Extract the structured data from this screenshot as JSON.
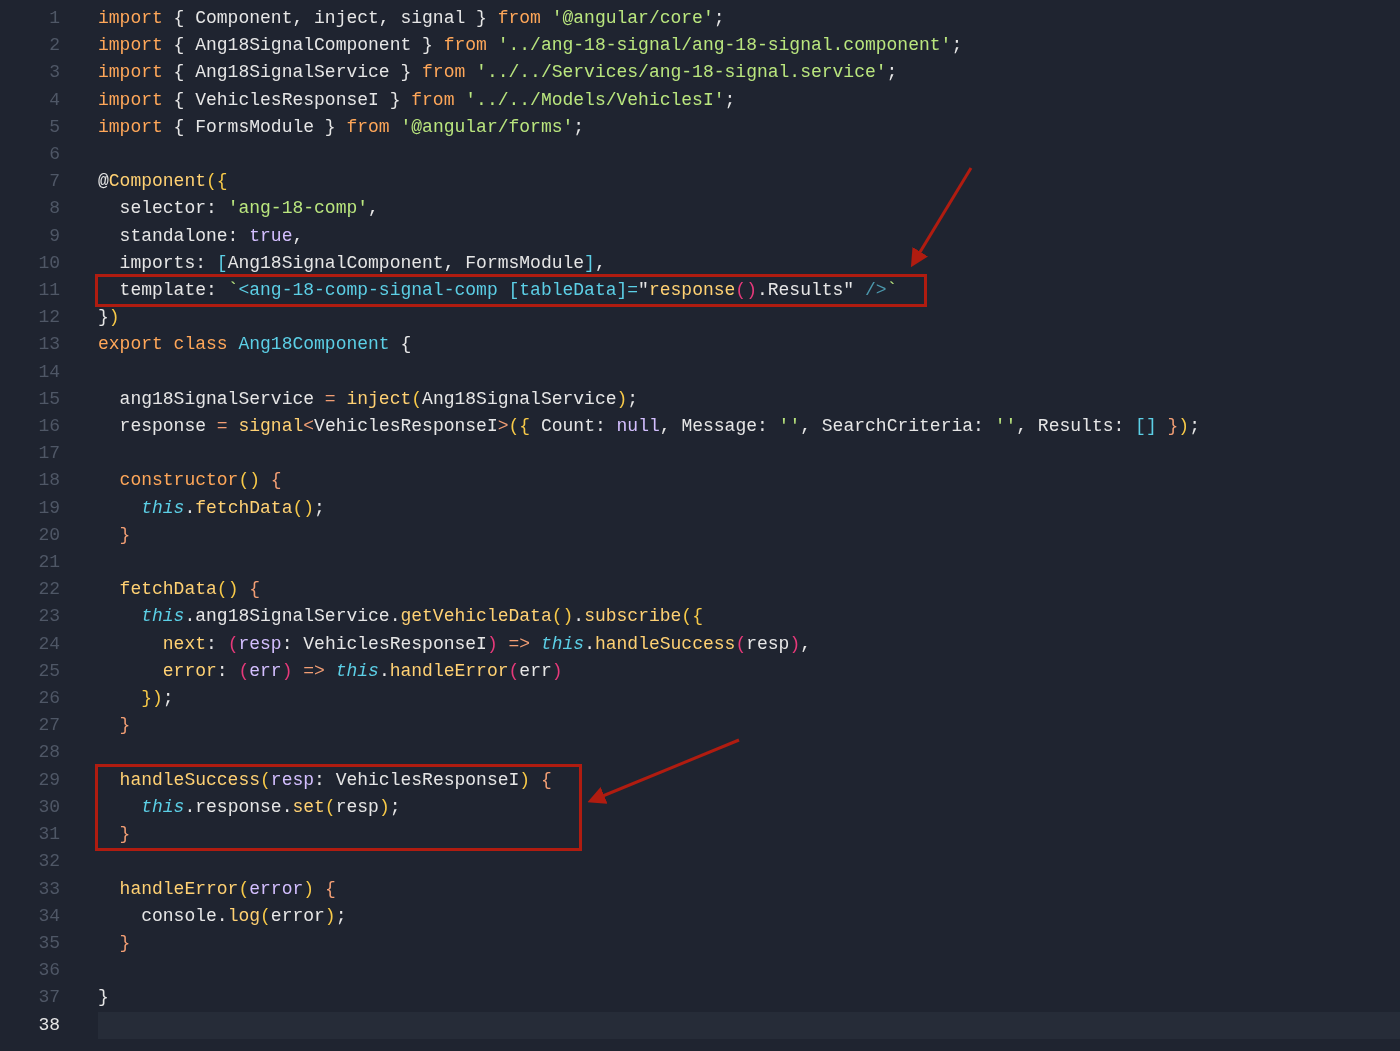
{
  "editor": {
    "lines": [
      {
        "number": "1",
        "current": false,
        "boxed": false,
        "tokens": [
          {
            "text": "import",
            "kind": "kw"
          },
          {
            "text": " { Component, inject, signal } ",
            "kind": "plain"
          },
          {
            "text": "from",
            "kind": "kw"
          },
          {
            "text": " '@angular/core'",
            "kind": "str"
          },
          {
            "text": ";",
            "kind": "plain"
          }
        ]
      },
      {
        "number": "2",
        "current": false,
        "boxed": false,
        "tokens": [
          {
            "text": "import",
            "kind": "kw"
          },
          {
            "text": " { Ang18SignalComponent } ",
            "kind": "plain"
          },
          {
            "text": "from",
            "kind": "kw"
          },
          {
            "text": " '../ang-18-signal/ang-18-signal.component'",
            "kind": "str"
          },
          {
            "text": ";",
            "kind": "plain"
          }
        ]
      },
      {
        "number": "3",
        "current": false,
        "boxed": false,
        "tokens": [
          {
            "text": "import",
            "kind": "kw"
          },
          {
            "text": " { Ang18SignalService } ",
            "kind": "plain"
          },
          {
            "text": "from",
            "kind": "kw"
          },
          {
            "text": " '../../Services/ang-18-signal.service'",
            "kind": "str"
          },
          {
            "text": ";",
            "kind": "plain"
          }
        ]
      },
      {
        "number": "4",
        "current": false,
        "boxed": false,
        "tokens": [
          {
            "text": "import",
            "kind": "kw"
          },
          {
            "text": " { VehiclesResponseI } ",
            "kind": "plain"
          },
          {
            "text": "from",
            "kind": "kw"
          },
          {
            "text": " '../../Models/VehiclesI'",
            "kind": "str"
          },
          {
            "text": ";",
            "kind": "plain"
          }
        ]
      },
      {
        "number": "5",
        "current": false,
        "boxed": false,
        "tokens": [
          {
            "text": "import",
            "kind": "kw"
          },
          {
            "text": " { FormsModule } ",
            "kind": "plain"
          },
          {
            "text": "from",
            "kind": "kw"
          },
          {
            "text": " '@angular/forms'",
            "kind": "str"
          },
          {
            "text": ";",
            "kind": "plain"
          }
        ]
      },
      {
        "number": "6",
        "current": false,
        "boxed": false
      },
      {
        "number": "7",
        "current": false,
        "boxed": false,
        "tokens": [
          {
            "text": "@",
            "kind": "plain"
          },
          {
            "text": "Component",
            "kind": "fn"
          },
          {
            "text": "({",
            "kind": "brace"
          }
        ]
      },
      {
        "number": "8",
        "current": false,
        "boxed": false,
        "tokens": [
          {
            "text": "  selector: ",
            "kind": "plain"
          },
          {
            "text": "'ang-18-comp'",
            "kind": "str"
          },
          {
            "text": ",",
            "kind": "plain"
          }
        ]
      },
      {
        "number": "9",
        "current": false,
        "boxed": false,
        "tokens": [
          {
            "text": "  standalone: ",
            "kind": "plain"
          },
          {
            "text": "true",
            "kind": "const"
          },
          {
            "text": ",",
            "kind": "plain"
          }
        ]
      },
      {
        "number": "10",
        "current": false,
        "boxed": false,
        "tokens": [
          {
            "text": "  imports: ",
            "kind": "plain"
          },
          {
            "text": "[",
            "kind": "cls"
          },
          {
            "text": "Ang18SignalComponent, FormsModule",
            "kind": "plain"
          },
          {
            "text": "]",
            "kind": "cls"
          },
          {
            "text": ",",
            "kind": "plain"
          }
        ]
      },
      {
        "number": "11",
        "current": false,
        "boxed": true,
        "tokens": [
          {
            "text": "  template: ",
            "kind": "plain"
          },
          {
            "text": "`",
            "kind": "str"
          },
          {
            "text": "<ang-18-comp-signal-comp [tableData]=",
            "kind": "cls"
          },
          {
            "text": "\"",
            "kind": "plain"
          },
          {
            "text": "response",
            "kind": "fn"
          },
          {
            "text": "()",
            "kind": "pink"
          },
          {
            "text": ".Results\"",
            "kind": "plain"
          },
          {
            "text": " />",
            "kind": "tagend"
          },
          {
            "text": "`",
            "kind": "str"
          }
        ]
      },
      {
        "number": "12",
        "current": false,
        "boxed": false,
        "tokens": [
          {
            "text": "}",
            "kind": "plain"
          },
          {
            "text": ")",
            "kind": "brace"
          }
        ]
      },
      {
        "number": "13",
        "current": false,
        "boxed": false,
        "tokens": [
          {
            "text": "export class",
            "kind": "kw"
          },
          {
            "text": " Ang18Component",
            "kind": "cls"
          },
          {
            "text": " {",
            "kind": "plain"
          }
        ]
      },
      {
        "number": "14",
        "current": false,
        "boxed": false
      },
      {
        "number": "15",
        "current": false,
        "boxed": false,
        "tokens": [
          {
            "text": "  ang18SignalService ",
            "kind": "plain"
          },
          {
            "text": "=",
            "kind": "op"
          },
          {
            "text": " inject",
            "kind": "fn"
          },
          {
            "text": "(",
            "kind": "brace"
          },
          {
            "text": "Ang18SignalService",
            "kind": "plain"
          },
          {
            "text": ")",
            "kind": "brace"
          },
          {
            "text": ";",
            "kind": "plain"
          }
        ]
      },
      {
        "number": "16",
        "current": false,
        "boxed": false,
        "tokens": [
          {
            "text": "  response ",
            "kind": "plain"
          },
          {
            "text": "=",
            "kind": "op"
          },
          {
            "text": " signal",
            "kind": "fn"
          },
          {
            "text": "<",
            "kind": "op"
          },
          {
            "text": "VehiclesResponseI",
            "kind": "plain"
          },
          {
            "text": ">",
            "kind": "op"
          },
          {
            "text": "({",
            "kind": "brace"
          },
          {
            "text": " Count: ",
            "kind": "plain"
          },
          {
            "text": "null",
            "kind": "const"
          },
          {
            "text": ", Message: ",
            "kind": "plain"
          },
          {
            "text": "''",
            "kind": "str"
          },
          {
            "text": ", SearchCriteria: ",
            "kind": "plain"
          },
          {
            "text": "''",
            "kind": "str"
          },
          {
            "text": ", Results: ",
            "kind": "plain"
          },
          {
            "text": "[]",
            "kind": "cls"
          },
          {
            "text": " }",
            "kind": "op"
          },
          {
            "text": ")",
            "kind": "brace"
          },
          {
            "text": ";",
            "kind": "plain"
          }
        ]
      },
      {
        "number": "17",
        "current": false,
        "boxed": false
      },
      {
        "number": "18",
        "current": false,
        "boxed": false,
        "tokens": [
          {
            "text": "  constructor",
            "kind": "kw"
          },
          {
            "text": "()",
            "kind": "brace"
          },
          {
            "text": " {",
            "kind": "op"
          }
        ]
      },
      {
        "number": "19",
        "current": false,
        "boxed": false,
        "tokens": [
          {
            "text": "    this",
            "kind": "this"
          },
          {
            "text": ".",
            "kind": "plain"
          },
          {
            "text": "fetchData",
            "kind": "fn"
          },
          {
            "text": "()",
            "kind": "brace"
          },
          {
            "text": ";",
            "kind": "plain"
          }
        ]
      },
      {
        "number": "20",
        "current": false,
        "boxed": false,
        "tokens": [
          {
            "text": "  }",
            "kind": "op"
          }
        ]
      },
      {
        "number": "21",
        "current": false,
        "boxed": false
      },
      {
        "number": "22",
        "current": false,
        "boxed": false,
        "tokens": [
          {
            "text": "  fetchData",
            "kind": "fn"
          },
          {
            "text": "()",
            "kind": "brace"
          },
          {
            "text": " {",
            "kind": "op"
          }
        ]
      },
      {
        "number": "23",
        "current": false,
        "boxed": false,
        "tokens": [
          {
            "text": "    this",
            "kind": "this"
          },
          {
            "text": ".ang18SignalService.",
            "kind": "plain"
          },
          {
            "text": "getVehicleData",
            "kind": "fn"
          },
          {
            "text": "()",
            "kind": "brace"
          },
          {
            "text": ".",
            "kind": "plain"
          },
          {
            "text": "subscribe",
            "kind": "fn"
          },
          {
            "text": "({",
            "kind": "brace"
          }
        ]
      },
      {
        "number": "24",
        "current": false,
        "boxed": false,
        "tokens": [
          {
            "text": "      next",
            "kind": "fn"
          },
          {
            "text": ": ",
            "kind": "plain"
          },
          {
            "text": "(",
            "kind": "pink"
          },
          {
            "text": "resp",
            "kind": "const"
          },
          {
            "text": ": VehiclesResponseI",
            "kind": "plain"
          },
          {
            "text": ")",
            "kind": "pink"
          },
          {
            "text": " =>",
            "kind": "op"
          },
          {
            "text": " this",
            "kind": "this"
          },
          {
            "text": ".",
            "kind": "plain"
          },
          {
            "text": "handleSuccess",
            "kind": "fn"
          },
          {
            "text": "(",
            "kind": "pink"
          },
          {
            "text": "resp",
            "kind": "plain"
          },
          {
            "text": ")",
            "kind": "pink"
          },
          {
            "text": ",",
            "kind": "plain"
          }
        ]
      },
      {
        "number": "25",
        "current": false,
        "boxed": false,
        "tokens": [
          {
            "text": "      error",
            "kind": "fn"
          },
          {
            "text": ": ",
            "kind": "plain"
          },
          {
            "text": "(",
            "kind": "pink"
          },
          {
            "text": "err",
            "kind": "const"
          },
          {
            "text": ")",
            "kind": "pink"
          },
          {
            "text": " =>",
            "kind": "op"
          },
          {
            "text": " this",
            "kind": "this"
          },
          {
            "text": ".",
            "kind": "plain"
          },
          {
            "text": "handleError",
            "kind": "fn"
          },
          {
            "text": "(",
            "kind": "pink"
          },
          {
            "text": "err",
            "kind": "plain"
          },
          {
            "text": ")",
            "kind": "pink"
          }
        ]
      },
      {
        "number": "26",
        "current": false,
        "boxed": false,
        "tokens": [
          {
            "text": "    })",
            "kind": "brace"
          },
          {
            "text": ";",
            "kind": "plain"
          }
        ]
      },
      {
        "number": "27",
        "current": false,
        "boxed": false,
        "tokens": [
          {
            "text": "  }",
            "kind": "op"
          }
        ]
      },
      {
        "number": "28",
        "current": false,
        "boxed": false
      },
      {
        "number": "29",
        "current": false,
        "boxed": true,
        "tokens": [
          {
            "text": "  handleSuccess",
            "kind": "fn"
          },
          {
            "text": "(",
            "kind": "brace"
          },
          {
            "text": "resp",
            "kind": "const"
          },
          {
            "text": ": VehiclesResponseI",
            "kind": "plain"
          },
          {
            "text": ")",
            "kind": "brace"
          },
          {
            "text": " {",
            "kind": "op"
          }
        ]
      },
      {
        "number": "30",
        "current": false,
        "boxed": true,
        "tokens": [
          {
            "text": "    this",
            "kind": "this"
          },
          {
            "text": ".response.",
            "kind": "plain"
          },
          {
            "text": "set",
            "kind": "fn"
          },
          {
            "text": "(",
            "kind": "brace"
          },
          {
            "text": "resp",
            "kind": "plain"
          },
          {
            "text": ")",
            "kind": "brace"
          },
          {
            "text": ";",
            "kind": "plain"
          }
        ]
      },
      {
        "number": "31",
        "current": false,
        "boxed": true,
        "tokens": [
          {
            "text": "  }",
            "kind": "op"
          }
        ]
      },
      {
        "number": "32",
        "current": false,
        "boxed": false
      },
      {
        "number": "33",
        "current": false,
        "boxed": false,
        "tokens": [
          {
            "text": "  handleError",
            "kind": "fn"
          },
          {
            "text": "(",
            "kind": "brace"
          },
          {
            "text": "error",
            "kind": "const"
          },
          {
            "text": ")",
            "kind": "brace"
          },
          {
            "text": " {",
            "kind": "op"
          }
        ]
      },
      {
        "number": "34",
        "current": false,
        "boxed": false,
        "tokens": [
          {
            "text": "    console.",
            "kind": "plain"
          },
          {
            "text": "log",
            "kind": "fn"
          },
          {
            "text": "(",
            "kind": "brace"
          },
          {
            "text": "error",
            "kind": "plain"
          },
          {
            "text": ")",
            "kind": "brace"
          },
          {
            "text": ";",
            "kind": "plain"
          }
        ]
      },
      {
        "number": "35",
        "current": false,
        "boxed": false,
        "tokens": [
          {
            "text": "  }",
            "kind": "op"
          }
        ]
      },
      {
        "number": "36",
        "current": false,
        "boxed": false
      },
      {
        "number": "37",
        "current": false,
        "boxed": false,
        "tokens": [
          {
            "text": "}",
            "kind": "plain"
          }
        ]
      },
      {
        "number": "38",
        "current": true,
        "boxed": false
      }
    ],
    "arrows": [
      {
        "kind": "steep"
      },
      {
        "kind": "shallow"
      }
    ]
  }
}
